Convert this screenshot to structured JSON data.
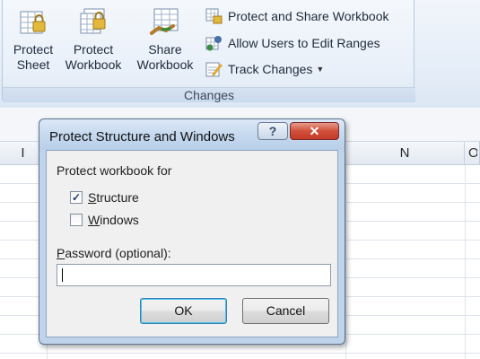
{
  "ribbon": {
    "group_label": "Changes",
    "big_buttons": [
      {
        "line1": "Protect",
        "line2": "Sheet",
        "icon": "protect-sheet-icon"
      },
      {
        "line1": "Protect",
        "line2": "Workbook",
        "icon": "protect-workbook-icon"
      },
      {
        "line1": "Share",
        "line2": "Workbook",
        "icon": "share-workbook-icon"
      }
    ],
    "small_buttons": [
      {
        "label": "Protect and Share Workbook",
        "icon": "protect-share-icon"
      },
      {
        "label": "Allow Users to Edit Ranges",
        "icon": "edit-ranges-icon"
      },
      {
        "label": "Track Changes",
        "icon": "track-changes-icon"
      }
    ]
  },
  "sheet": {
    "columns": [
      "I",
      "N",
      "O"
    ]
  },
  "dialog": {
    "title": "Protect Structure and Windows",
    "help_label": "?",
    "close_label": "✕",
    "section_label": "Protect workbook for",
    "structure": {
      "label": "Structure",
      "checked": true
    },
    "windows": {
      "label": "Windows",
      "checked": false
    },
    "password_label": "Password (optional):",
    "password_value": "",
    "ok_label": "OK",
    "cancel_label": "Cancel"
  },
  "colors": {
    "ribbon_bg": "#e6eef8",
    "dialog_frame": "#bfd3ea",
    "close_red": "#c23a26",
    "ok_focus": "#48c1ec"
  }
}
